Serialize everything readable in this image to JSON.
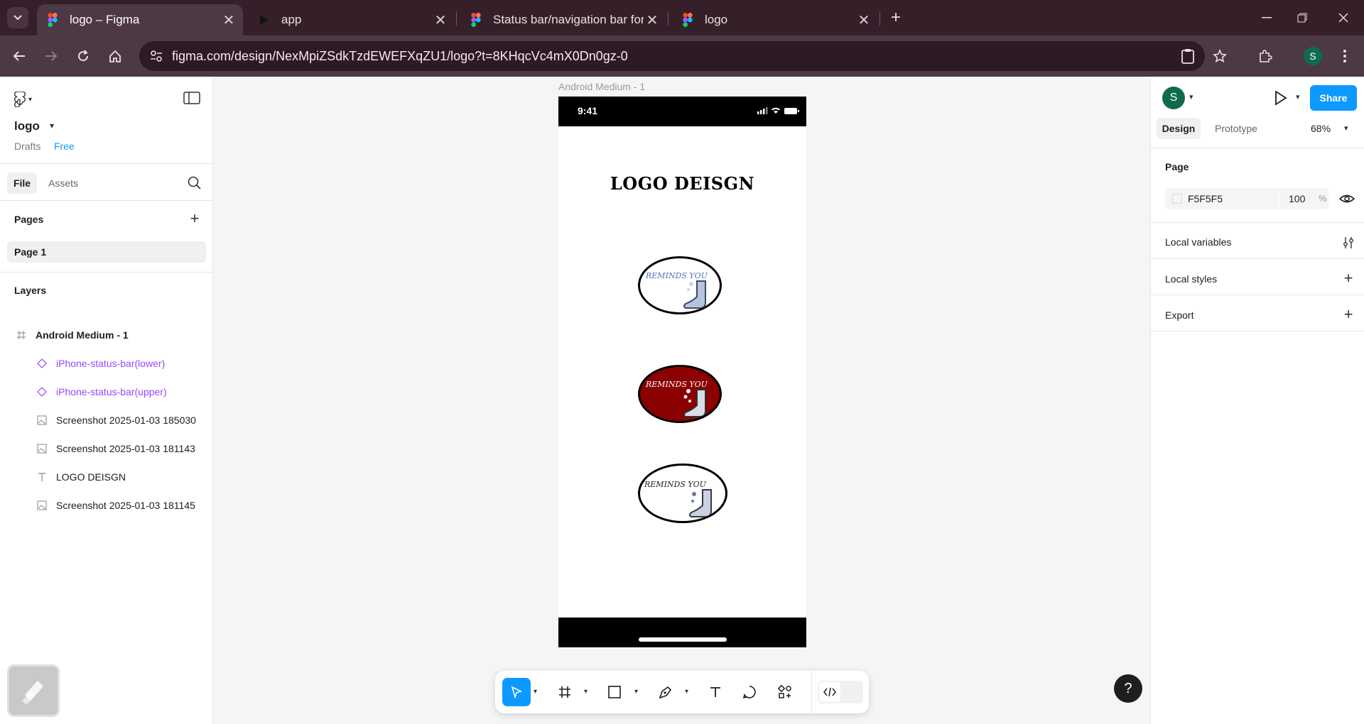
{
  "browser": {
    "tabs": [
      {
        "label": "logo – Figma",
        "active": true
      },
      {
        "label": "app",
        "active": false
      },
      {
        "label": "Status bar/navigation bar for iPhone",
        "active": false
      },
      {
        "label": "logo",
        "active": false
      }
    ],
    "url": "figma.com/design/NexMpiZSdkTzdEWEFXqZU1/logo?t=8KHqcVc4mX0Dn0gz-0",
    "profile_initial": "S"
  },
  "left_panel": {
    "file_name": "logo",
    "drafts": "Drafts",
    "plan_badge": "Free",
    "tab_file": "File",
    "tab_assets": "Assets",
    "pages_heading": "Pages",
    "pages": [
      "Page 1"
    ],
    "layers_heading": "Layers",
    "layers": [
      {
        "name": "Android Medium - 1",
        "kind": "frame"
      },
      {
        "name": "iPhone-status-bar(lower)",
        "kind": "component"
      },
      {
        "name": "iPhone-status-bar(upper)",
        "kind": "component"
      },
      {
        "name": "Screenshot 2025-01-03 185030",
        "kind": "image"
      },
      {
        "name": "Screenshot 2025-01-03 181143",
        "kind": "image"
      },
      {
        "name": "LOGO DEISGN",
        "kind": "text"
      },
      {
        "name": "Screenshot 2025-01-03 181145",
        "kind": "image"
      }
    ]
  },
  "canvas": {
    "frame_label": "Android Medium - 1",
    "status_time": "9:41",
    "title": "LOGO DEISGN",
    "logos": [
      {
        "text": "REMINDS YOU",
        "background": "#ffffff",
        "text_color": "#5b6fb5"
      },
      {
        "text": "REMINDS YOU",
        "background": "#8b0000",
        "text_color": "#ffffff"
      },
      {
        "text": "REMINDS YOU",
        "background": "#ffffff",
        "text_color": "#222222"
      }
    ]
  },
  "toolbar": {
    "tools": [
      "move-tool",
      "frame-tool",
      "rectangle-tool",
      "pen-tool",
      "text-tool",
      "comment-tool",
      "actions-tool",
      "dev-mode-toggle"
    ]
  },
  "right_panel": {
    "user_initial": "S",
    "share_label": "Share",
    "tab_design": "Design",
    "tab_prototype": "Prototype",
    "zoom": "68%",
    "page_heading": "Page",
    "page_fill_hex": "F5F5F5",
    "page_fill_opacity": "100",
    "opacity_unit": "%",
    "local_variables": "Local variables",
    "local_styles": "Local styles",
    "export": "Export"
  },
  "help_label": "?",
  "colors": {
    "accent": "#0d99ff",
    "component": "#9747ff",
    "browser_frame": "#35202a"
  }
}
